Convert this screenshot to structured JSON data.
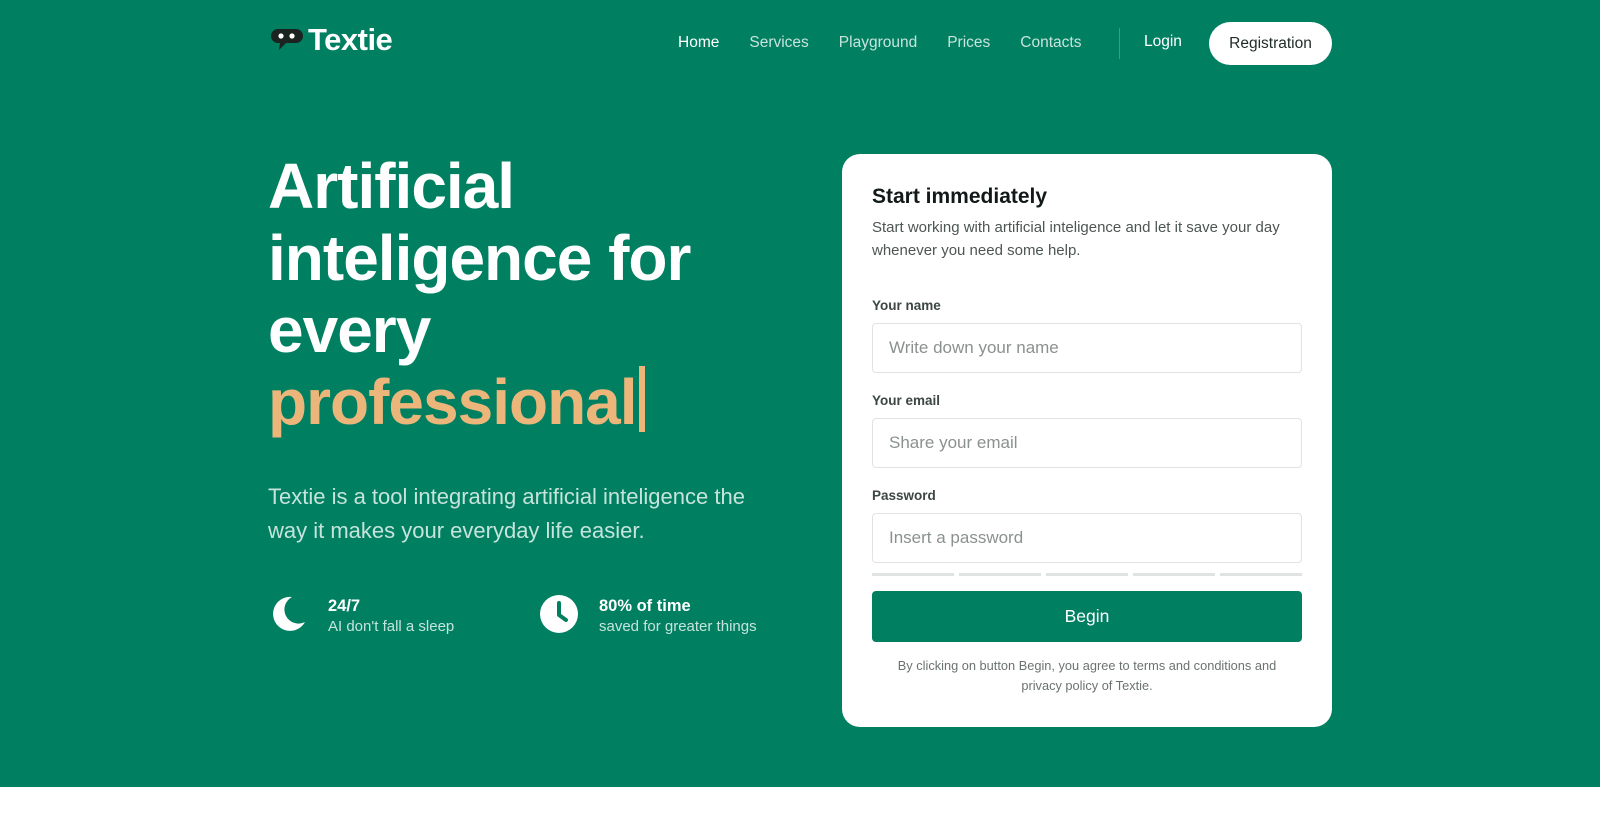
{
  "brand": {
    "name": "Textie",
    "icon": "speech-bubble-icon"
  },
  "nav": {
    "items": [
      {
        "label": "Home",
        "active": true
      },
      {
        "label": "Services",
        "active": false
      },
      {
        "label": "Playground",
        "active": false
      },
      {
        "label": "Prices",
        "active": false
      },
      {
        "label": "Contacts",
        "active": false
      }
    ],
    "login_label": "Login",
    "register_label": "Registration"
  },
  "hero": {
    "headline_lines": [
      "Artificial",
      "inteligence for",
      "every"
    ],
    "headline_accent": "professional",
    "subtext": "Textie is a tool integrating artificial inteligence the way it makes your everyday life easier.",
    "features": [
      {
        "icon": "moon-icon",
        "title": "24/7",
        "subtitle": "AI don't fall a sleep"
      },
      {
        "icon": "clock-icon",
        "title": "80% of time",
        "subtitle": "saved for greater things"
      }
    ]
  },
  "form": {
    "title": "Start immediately",
    "description": "Start working with artificial inteligence and let it save your day whenever you need some help.",
    "name_label": "Your name",
    "name_placeholder": "Write down your name",
    "email_label": "Your email",
    "email_placeholder": "Share your email",
    "password_label": "Password",
    "password_placeholder": "Insert a password",
    "submit_label": "Begin",
    "terms": "By clicking on button Begin, you agree to terms and conditions and privacy policy of Textie."
  },
  "colors": {
    "primary": "#017f61",
    "accent": "#ecb67a",
    "muted_text": "#c6e4dc",
    "card_bg": "#ffffff"
  }
}
